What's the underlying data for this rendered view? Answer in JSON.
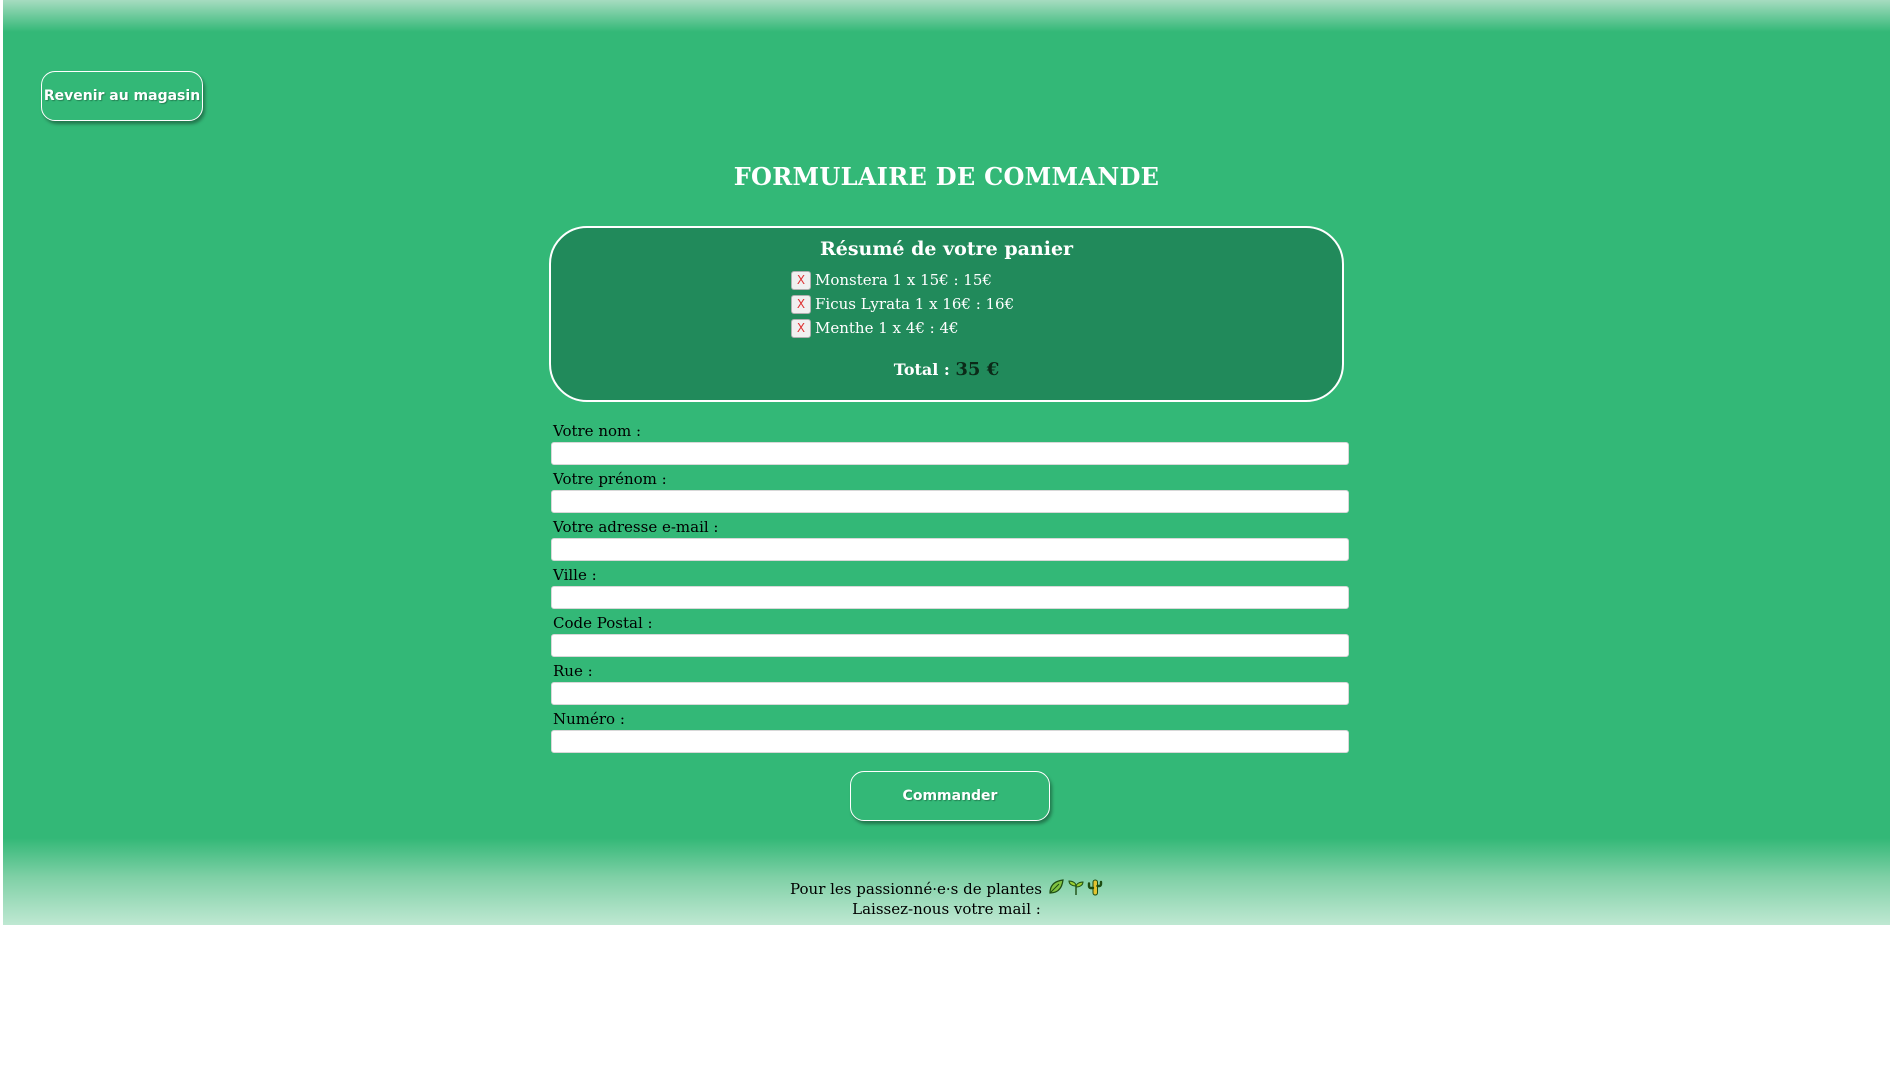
{
  "header": {
    "back_button_label": "Revenir au magasin"
  },
  "main": {
    "title": "FORMULAIRE DE COMMANDE"
  },
  "cart": {
    "title": "Résumé de votre panier",
    "remove_label": "X",
    "items": [
      {
        "text": "Monstera 1 x 15€ : 15€"
      },
      {
        "text": "Ficus Lyrata 1 x 16€ : 16€"
      },
      {
        "text": "Menthe 1 x 4€ : 4€"
      }
    ],
    "total_label": "Total :",
    "total_value": "35 €"
  },
  "form": {
    "fields": [
      {
        "label": "Votre nom :",
        "value": ""
      },
      {
        "label": "Votre prénom :",
        "value": ""
      },
      {
        "label": "Votre adresse e-mail :",
        "value": ""
      },
      {
        "label": "Ville :",
        "value": ""
      },
      {
        "label": "Code Postal :",
        "value": ""
      },
      {
        "label": "Rue :",
        "value": ""
      },
      {
        "label": "Numéro :",
        "value": ""
      }
    ],
    "submit_label": "Commander"
  },
  "footer": {
    "tagline": "Pour les passionné·e·s de plantes",
    "icons": [
      "leaf-icon",
      "seedling-icon",
      "cactus-icon"
    ],
    "newsletter_label": "Laissez-nous votre mail :"
  },
  "colors": {
    "background": "#33b877",
    "summary_background": "#218a5b",
    "text_light": "#ffffff"
  }
}
